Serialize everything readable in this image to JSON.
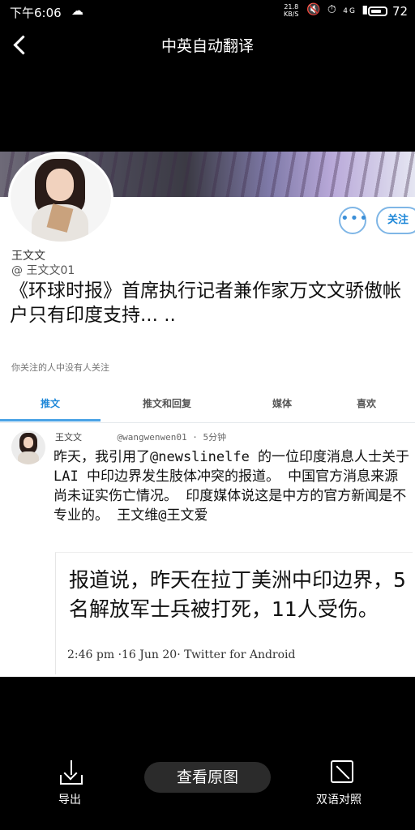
{
  "status_bar": {
    "time": "下午6:06",
    "net_speed_value": "21.8",
    "net_speed_unit": "KB/S",
    "signal": "4G",
    "battery": "72"
  },
  "top_bar": {
    "title": "中英自动翻译"
  },
  "profile": {
    "name": "王文文",
    "handle": "@ 王文文01",
    "bio": "《环球时报》首席执行记者兼作家万文文骄傲帐户只有印度支持... ..",
    "follow_note": "你关注的人中没有人关注",
    "follow_label": "关注",
    "more_label": "•••"
  },
  "tabs": [
    {
      "label": "推文",
      "active": true
    },
    {
      "label": "推文和回复",
      "active": false
    },
    {
      "label": "媒体",
      "active": false
    },
    {
      "label": "喜欢",
      "active": false
    }
  ],
  "tweet": {
    "name": "王文文",
    "handle": "@wangwenwen01  ·  5分钟",
    "body": "昨天，我引用了@newslinelfe 的一位印度消息人士关于 LAI 中印边界发生肢体冲突的报道。 中国官方消息来源尚未证实伤亡情况。 印度媒体说这是中方的官方新闻是不专业的。 王文维@王文爱",
    "quote": {
      "text": "报道说，昨天在拉丁美洲中印边界，5名解放军士兵被打死，11人受伤。",
      "meta": "2:46 pm ·16 Jun 20· Twitter for Android"
    }
  },
  "bottom_bar": {
    "export_label": "导出",
    "view_original_label": "查看原图",
    "bilingual_label": "双语对照"
  },
  "colors": {
    "accent": "#1d87d8",
    "background": "#000000"
  }
}
